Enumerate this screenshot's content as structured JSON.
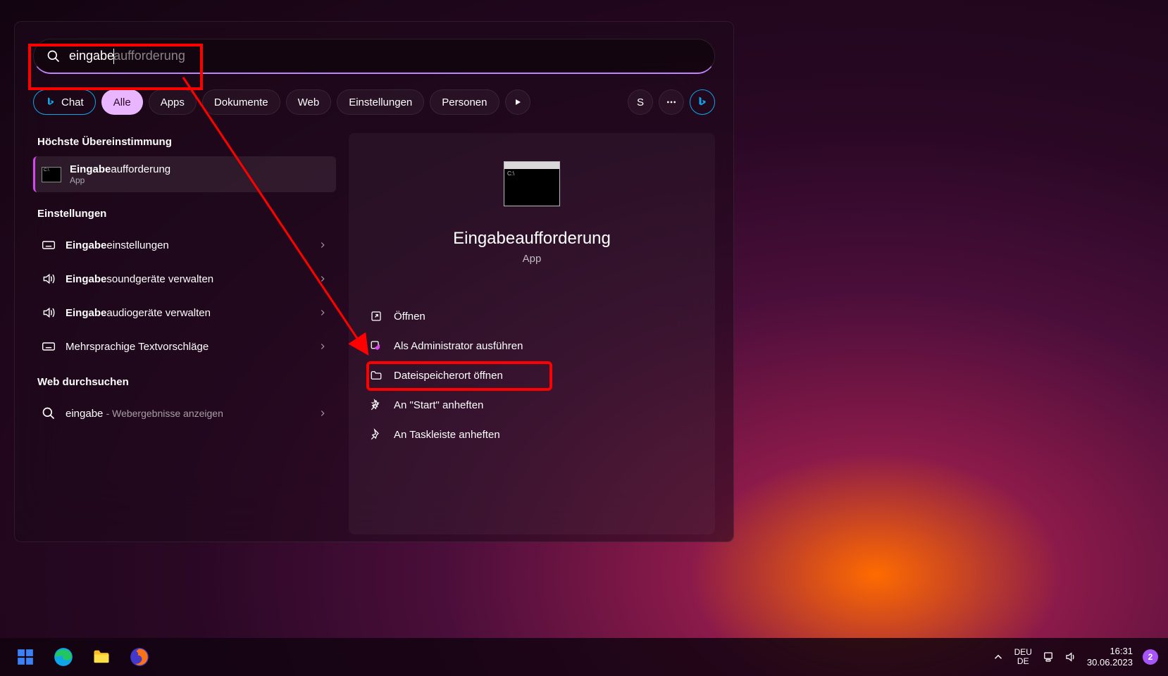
{
  "search": {
    "typed": "eingabe",
    "completion": "aufforderung"
  },
  "filters": {
    "chat": "Chat",
    "all": "Alle",
    "apps": "Apps",
    "documents": "Dokumente",
    "web": "Web",
    "settings": "Einstellungen",
    "people": "Personen",
    "avatar_letter": "S"
  },
  "left": {
    "best_match_title": "Höchste Übereinstimmung",
    "best_match_item": {
      "bold": "Eingabe",
      "rest": "aufforderung",
      "sub": "App"
    },
    "settings_title": "Einstellungen",
    "settings_items": [
      {
        "bold": "Eingabe",
        "rest": "einstellungen",
        "icon": "keyboard"
      },
      {
        "bold": "Eingabe",
        "rest": "soundgeräte verwalten",
        "icon": "sound"
      },
      {
        "bold": "Eingabe",
        "rest": "audiogeräte verwalten",
        "icon": "sound"
      },
      {
        "bold": "",
        "rest": "Mehrsprachige Textvorschläge",
        "icon": "keyboard"
      }
    ],
    "web_title": "Web durchsuchen",
    "web_item": {
      "term": "eingabe",
      "sub": "- Webergebnisse anzeigen"
    }
  },
  "right": {
    "title": "Eingabeaufforderung",
    "subtype": "App",
    "actions": [
      {
        "label": "Öffnen",
        "icon": "open"
      },
      {
        "label": "Als Administrator ausführen",
        "icon": "admin"
      },
      {
        "label": "Dateispeicherort öffnen",
        "icon": "folder"
      },
      {
        "label": "An \"Start\" anheften",
        "icon": "pin"
      },
      {
        "label": "An Taskleiste anheften",
        "icon": "pin"
      }
    ]
  },
  "taskbar": {
    "lang1": "DEU",
    "lang2": "DE",
    "time": "16:31",
    "date": "30.06.2023",
    "badge": "2"
  }
}
